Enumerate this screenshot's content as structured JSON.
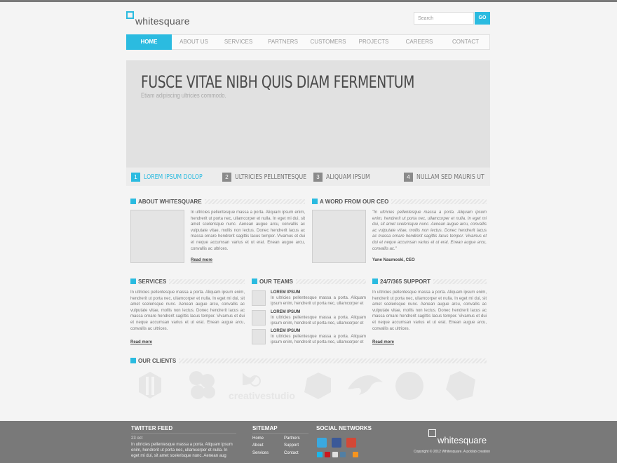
{
  "brand": {
    "name": "whitesquare"
  },
  "search": {
    "placeholder": "Search",
    "button": "GO"
  },
  "nav": {
    "items": [
      "HOME",
      "ABOUT US",
      "SERVICES",
      "PARTNERS",
      "CUSTOMERS",
      "PROJECTS",
      "CAREERS",
      "CONTACT"
    ],
    "active": 0
  },
  "hero": {
    "title": "FUSCE VITAE NIBH QUIS DIAM FERMENTUM",
    "subtitle": "Etiam adipiscing ultricies commodo."
  },
  "slides": [
    {
      "num": "1",
      "label": "LOREM IPSUM DOLOP"
    },
    {
      "num": "2",
      "label": "ULTRICIES PELLENTESQUE"
    },
    {
      "num": "3",
      "label": "ALIQUAM IPSUM"
    },
    {
      "num": "4",
      "label": "NULLAM SED MAURIS UT"
    }
  ],
  "about": {
    "heading": "ABOUT WHITESQUARE",
    "text": "In ultricies pellentesque massa a porta. Aliquam ipsum enim, hendrerit ut porta nec, ullamcorper et nulla. In eget mi dui, sit amet scelerisque nunc. Aenean augue arcu, convallis ac vulputate vitae, mollis non lectus. Donec hendrerit lacus ac massa ornare hendrerit sagittis lacus tempor. Vivamus et dui et neque accumsan varius et ut erat. Enean augue arcu, convallis ac ultrices.",
    "read_more": "Read more"
  },
  "ceo": {
    "heading": "A WORD FROM OUR CEO",
    "quote": "\"In ultricies pellentesque massa a porta. Aliquam ipsum enim, hendrerit ut porta nec, ullamcorper et nulla. In eget mi dui, sit amet scelerisque nunc. Aenean augue arcu, convallis ac vulputate vitae, mollis non lectus. Donec hendrerit lacus ac massa ornare hendrerit sagittis lacus tempor. Vivamus et dui et neque accumsan varius et ut erat. Enean augue arcu, convallis ac.\"",
    "name": "Yane Naumoski, CEO"
  },
  "services": {
    "heading": "SERVICES",
    "text": "In ultricies pellentesque massa a porta. Aliquam ipsum enim, hendrerit ut porta nec, ullamcorper et nulla. In eget mi dui, sit amet scelerisque nunc. Aenean augue arcu, convallis ac vulputate vitae, mollis non lectus. Donec hendrerit lacus ac massa ornare hendrerit sagittis lacus tempor. Vivamus et dui et neque accumsan varius et ut erat. Enean augue arcu, convallis ac ultrices.",
    "read_more": "Read more"
  },
  "teams": {
    "heading": "OUR TEAMS",
    "items": [
      {
        "name": "LOREM IPSUM",
        "text": "In ultricies pellentesque massa a porta. Aliquam ipsum enim, hendrerit ut porta nec, ullamcorper et"
      },
      {
        "name": "LOREM IPSUM",
        "text": "In ultricies pellentesque massa a porta. Aliquam ipsum enim, hendrerit ut porta nec, ullamcorper et"
      },
      {
        "name": "LOREM IPSUM",
        "text": "In ultricies pellentesque massa a porta. Aliquam ipsum enim, hendrerit ut porta nec, ullamcorper et"
      }
    ]
  },
  "support": {
    "heading": "24/7/365 SUPPORT",
    "text": "In ultricies pellentesque massa a porta. Aliquam ipsum enim, hendrerit ut porta nec, ullamcorper et nulla. In eget mi dui, sit amet scelerisque nunc. Aenean augue arcu, convallis ac vulputate vitae, mollis non lectus. Donec hendrerit lacus ac massa ornare hendrerit sagittis lacus tempor. Vivamus et dui et neque accumsan varius et ut erat. Enean augue arcu, convallis ac ultrices.",
    "read_more": "Read more"
  },
  "clients": {
    "heading": "OUR CLIENTS",
    "wordmark": "creativestudio"
  },
  "footer": {
    "twitter_heading": "TWITTER FEED",
    "tweet_date": "23 oct",
    "tweet_text": "In ultricies pellentesque massa a porta. Aliquam ipsum enim, hendrerit ut porta nec, ullamcorper et nulla. In eget mi dui, sit amet scelerisque nunc. Aenean aug",
    "sitemap_heading": "SITEMAP",
    "sitemap_col1": [
      "Home",
      "About",
      "Services"
    ],
    "sitemap_col2": [
      "Partners",
      "Support",
      "Contact"
    ],
    "social_heading": "SOCIAL NETWORKS",
    "social_icons": [
      "twitter-icon",
      "facebook-icon",
      "google-plus-icon",
      "vimeo-icon",
      "youtube-icon",
      "flickr-icon",
      "instagram-icon",
      "rss-icon"
    ],
    "brand": "whitesquare",
    "copyright": "Copyright © 2012 Whitesquare. A pcklab creation"
  },
  "colors": {
    "accent": "#2bbbe0",
    "footer_bg": "#797979",
    "page_bg": "#f4f4f4"
  }
}
